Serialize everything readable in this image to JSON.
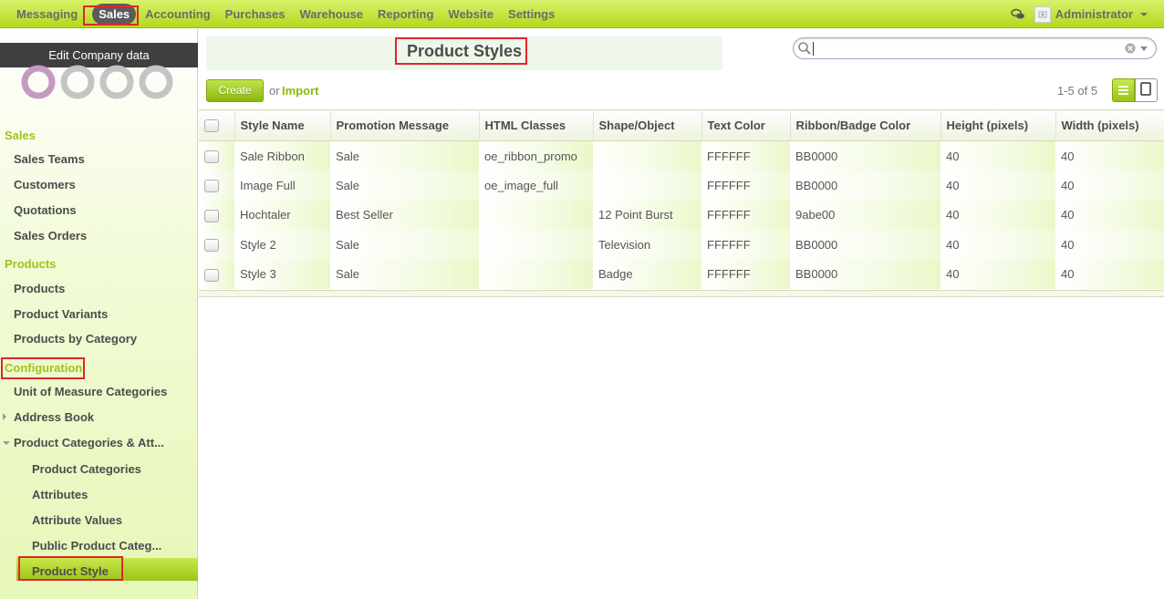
{
  "topmenu": {
    "items": [
      "Messaging",
      "Sales",
      "Accounting",
      "Purchases",
      "Warehouse",
      "Reporting",
      "Website",
      "Settings"
    ],
    "active": "Sales",
    "user": "Administrator"
  },
  "sidebar": {
    "edit_company": "Edit Company data",
    "sections": {
      "sales": "Sales",
      "products": "Products",
      "configuration": "Configuration"
    },
    "items": {
      "sales_teams": "Sales Teams",
      "customers": "Customers",
      "quotations": "Quotations",
      "sales_orders": "Sales Orders",
      "products": "Products",
      "product_variants": "Product Variants",
      "products_by_category": "Products by Category",
      "uom_categories": "Unit of Measure Categories",
      "address_book": "Address Book",
      "product_categories_attr": "Product Categories & Att...",
      "product_categories": "Product Categories",
      "attributes": "Attributes",
      "attribute_values": "Attribute Values",
      "public_product_categ": "Public Product Categ...",
      "product_style": "Product Style"
    }
  },
  "main": {
    "title": "Product Styles",
    "search": {
      "value": "",
      "placeholder": ""
    },
    "create_label": "Create",
    "or_label": "or",
    "import_label": "Import",
    "pager": "1-5 of 5"
  },
  "table": {
    "headers": [
      "Style Name",
      "Promotion Message",
      "HTML Classes",
      "Shape/Object",
      "Text Color",
      "Ribbon/Badge Color",
      "Height (pixels)",
      "Width (pixels)"
    ],
    "rows": [
      [
        "Sale Ribbon",
        "Sale",
        "oe_ribbon_promo",
        "",
        "FFFFFF",
        "BB0000",
        "40",
        "40"
      ],
      [
        "Image Full",
        "Sale",
        "oe_image_full",
        "",
        "FFFFFF",
        "BB0000",
        "40",
        "40"
      ],
      [
        "Hochtaler",
        "Best Seller",
        "",
        "12 Point Burst",
        "FFFFFF",
        "9abe00",
        "40",
        "40"
      ],
      [
        "Style 2",
        "Sale",
        "",
        "Television",
        "FFFFFF",
        "BB0000",
        "40",
        "40"
      ],
      [
        "Style 3",
        "Sale",
        "",
        "Badge",
        "FFFFFF",
        "BB0000",
        "40",
        "40"
      ]
    ]
  },
  "colors": {
    "accent": "#a1c11b",
    "highlight": "#e0262b"
  }
}
